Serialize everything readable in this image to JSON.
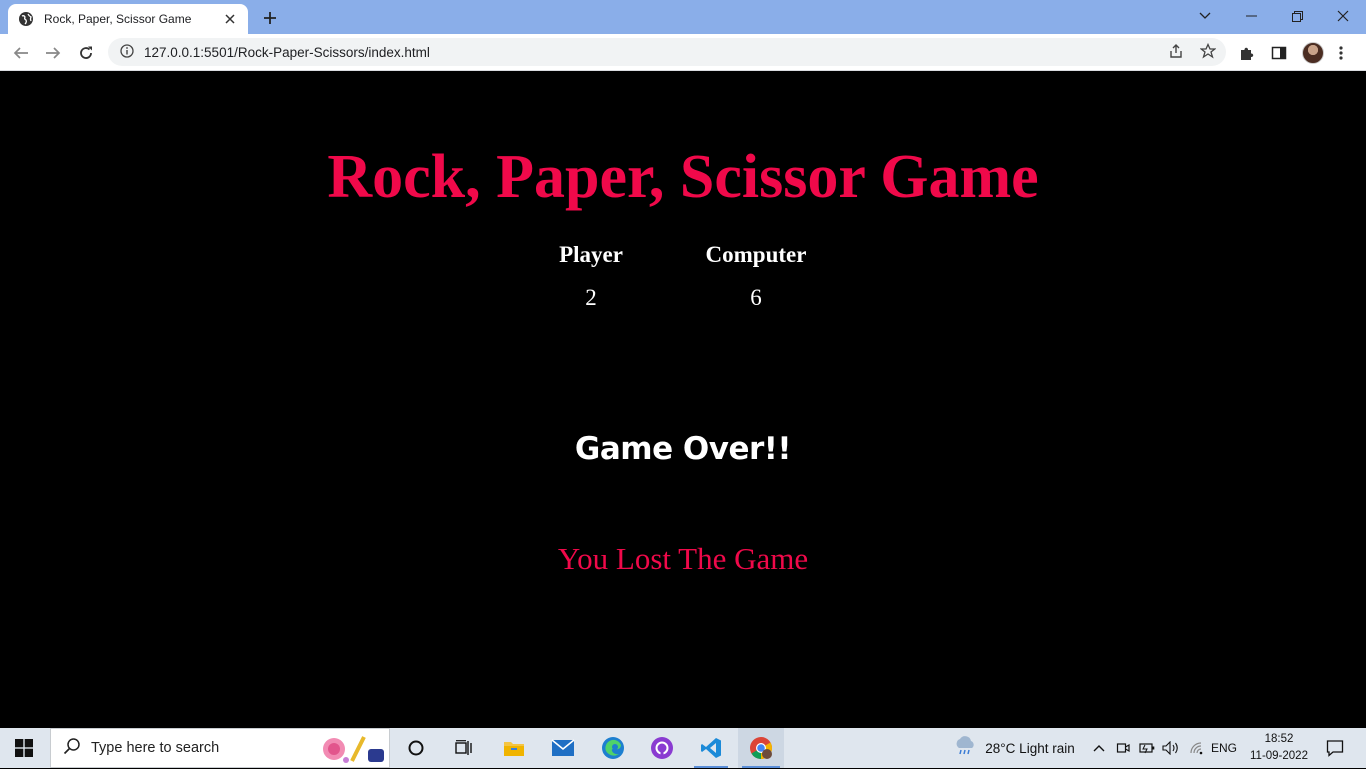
{
  "browser": {
    "tab_title": "Rock, Paper, Scissor Game",
    "url": "127.0.0.1:5501/Rock-Paper-Scissors/index.html"
  },
  "page": {
    "title": "Rock, Paper, Scissor Game",
    "player_label": "Player",
    "computer_label": "Computer",
    "player_score": "2",
    "computer_score": "6",
    "status": "Game Over!!",
    "result": "You Lost The Game"
  },
  "colors": {
    "accent": "#f0094a",
    "background": "#000000",
    "text": "#ffffff"
  },
  "taskbar": {
    "search_placeholder": "Type here to search",
    "weather": "28°C  Light rain",
    "language": "ENG",
    "time": "18:52",
    "date": "11-09-2022"
  }
}
